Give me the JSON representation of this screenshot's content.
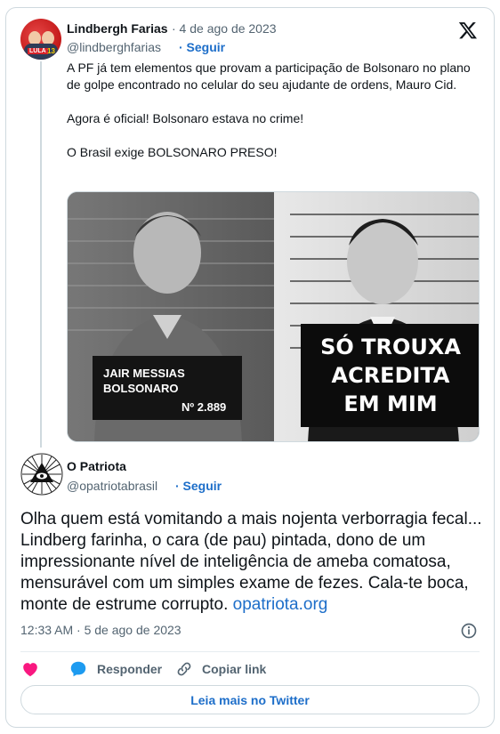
{
  "quoted_tweet": {
    "author_name": "Lindbergh Farias",
    "date": "· 4 de ago de 2023",
    "handle": "@lindberghfarias",
    "follow_label": "· Seguir",
    "text": "A PF já tem elementos que provam a participação de Bolsonaro no plano de golpe encontrado no celular do seu ajudante de ordens, Mauro Cid.\n\nAgora é oficial! Bolsonaro estava no crime!\n\nO Brasil exige BOLSONARO PRESO!",
    "avatar_tag": "LULA",
    "avatar_number": "13",
    "image": {
      "left_sign_line1": "JAIR MESSIAS",
      "left_sign_line2": "BOLSONARO",
      "left_sign_number": "Nº 2.889",
      "right_sign_line1": "SÓ TROUXA",
      "right_sign_line2": "ACREDITA",
      "right_sign_line3": "EM MIM"
    }
  },
  "main_tweet": {
    "author_name": "O Patriota",
    "handle": "@opatriotabrasil",
    "follow_label": "· Seguir",
    "text": "Olha quem está vomitando a mais nojenta verborragia fecal... Lindberg farinha, o cara (de pau) pintada, dono de um impressionante nível de inteligência de ameba comatosa, mensurável com um simples exame de fezes. Cala-te boca, monte de estrume corrupto. ",
    "link_text": "opatriota.org",
    "timestamp": "12:33 AM · 5 de ago de 2023"
  },
  "actions": {
    "reply_label": "Responder",
    "copy_label": "Copiar link",
    "read_more_label": "Leia mais no Twitter"
  },
  "colors": {
    "link": "#1d6ec9",
    "like": "#f91880",
    "reply": "#1d9bf0",
    "border": "#cfd9de"
  }
}
